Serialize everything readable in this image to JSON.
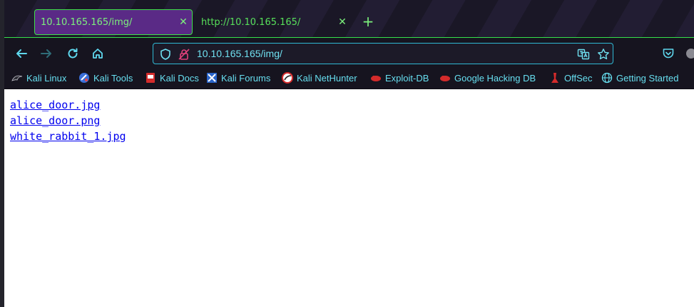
{
  "tabs": [
    {
      "label": "10.10.165.165/img/",
      "active": true
    },
    {
      "label": "http://10.10.165.165/",
      "active": false
    }
  ],
  "toolbar": {
    "url": "10.10.165.165/img/"
  },
  "bookmarks": [
    {
      "label": "Kali Linux",
      "icon": "kali-dragon-icon"
    },
    {
      "label": "Kali Tools",
      "icon": "kali-tools-icon"
    },
    {
      "label": "Kali Docs",
      "icon": "kali-docs-icon"
    },
    {
      "label": "Kali Forums",
      "icon": "kali-forums-icon"
    },
    {
      "label": "Kali NetHunter",
      "icon": "nethunter-icon"
    },
    {
      "label": "Exploit-DB",
      "icon": "exploitdb-icon"
    },
    {
      "label": "Google Hacking DB",
      "icon": "ghdb-icon"
    },
    {
      "label": "OffSec",
      "icon": "offsec-icon"
    },
    {
      "label": "Getting Started",
      "icon": "globe-icon"
    }
  ],
  "files": [
    {
      "name": "alice_door.jpg"
    },
    {
      "name": "alice_door.png"
    },
    {
      "name": "white_rabbit_1.jpg"
    }
  ],
  "colors": {
    "accent_green": "#3fe04a",
    "accent_cyan": "#2fb9d4",
    "active_tab": "#5a2a86",
    "link": "#0000ee"
  }
}
